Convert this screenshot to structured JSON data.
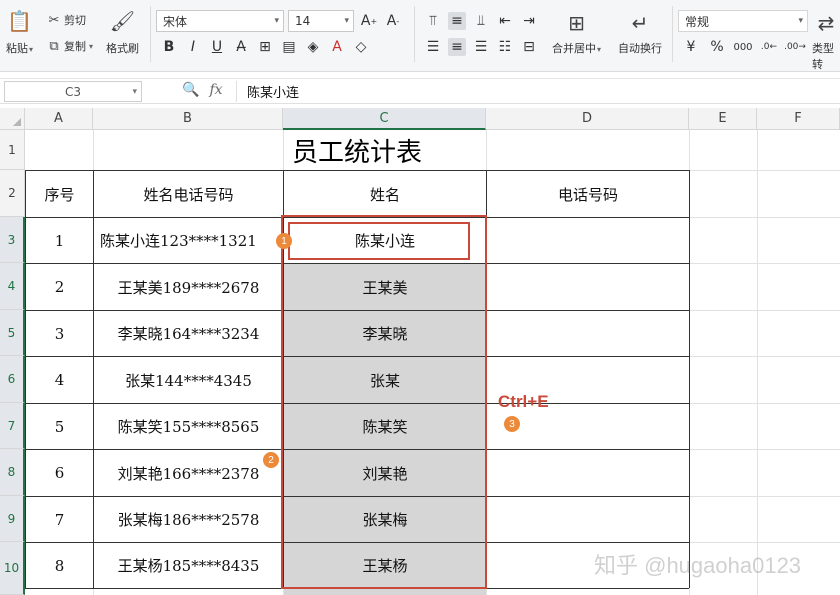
{
  "ribbon": {
    "paste": "粘贴",
    "cut": "剪切",
    "copy": "复制",
    "format_painter": "格式刷",
    "font_name": "宋体",
    "font_size": "14",
    "merge_center": "合并居中",
    "wrap_text": "自动换行",
    "number_format": "常规",
    "cell_type": "类型转"
  },
  "formula_bar": {
    "name_box": "C3",
    "fx": "fx",
    "content": "陈某小连"
  },
  "columns": [
    "A",
    "B",
    "C",
    "D",
    "E",
    "F"
  ],
  "active_column": "C",
  "rows": [
    "1",
    "2",
    "3",
    "4",
    "5",
    "6",
    "7",
    "8",
    "9",
    "10"
  ],
  "sheet": {
    "title": "员工统计表",
    "headers": [
      "序号",
      "姓名电话号码",
      "姓名",
      "电话号码"
    ],
    "records": [
      {
        "no": "1",
        "combined": "陈某小连123****1321",
        "name": "陈某小连",
        "phone": ""
      },
      {
        "no": "2",
        "combined": "王某美189****2678",
        "name": "王某美",
        "phone": ""
      },
      {
        "no": "3",
        "combined": "李某晓164****3234",
        "name": "李某晓",
        "phone": ""
      },
      {
        "no": "4",
        "combined": "张某144****4345",
        "name": "张某",
        "phone": ""
      },
      {
        "no": "5",
        "combined": "陈某笑155****8565",
        "name": "陈某笑",
        "phone": ""
      },
      {
        "no": "6",
        "combined": "刘某艳166****2378",
        "name": "刘某艳",
        "phone": ""
      },
      {
        "no": "7",
        "combined": "张某梅186****2578",
        "name": "张某梅",
        "phone": ""
      },
      {
        "no": "8",
        "combined": "王某杨185****8435",
        "name": "王某杨",
        "phone": ""
      }
    ]
  },
  "annotations": {
    "badge1": "1",
    "badge2": "2",
    "badge3": "3",
    "shortcut": "Ctrl+E",
    "watermark": "知乎 @hugaoha0123"
  },
  "colors": {
    "accent": "#217346",
    "highlight_red": "#c9493a",
    "badge_orange": "#ec8a39",
    "selection_gray": "#d6d6d6"
  }
}
